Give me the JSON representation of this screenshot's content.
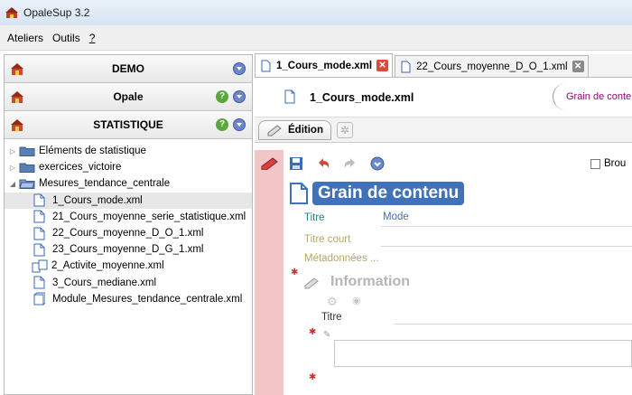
{
  "app": {
    "title": "OpaleSup 3.2"
  },
  "menu": [
    {
      "label": "Ateliers"
    },
    {
      "label": "Outils"
    },
    {
      "label": "?"
    }
  ],
  "workspaces": [
    {
      "name": "DEMO",
      "has_help": false
    },
    {
      "name": "Opale",
      "has_help": true
    },
    {
      "name": "STATISTIQUE",
      "has_help": true
    }
  ],
  "tree": [
    {
      "label": "Eléments de statistique",
      "type": "folder",
      "expanded": false
    },
    {
      "label": "exercices_victoire",
      "type": "folder",
      "expanded": false
    },
    {
      "label": "Mesures_tendance_centrale",
      "type": "folder",
      "expanded": true
    },
    {
      "label": "1_Cours_mode.xml",
      "type": "file",
      "selected": true
    },
    {
      "label": "21_Cours_moyenne_serie_statistique.xml",
      "type": "file"
    },
    {
      "label": "22_Cours_moyenne_D_O_1.xml",
      "type": "file"
    },
    {
      "label": "23_Cours_moyenne_D_G_1.xml",
      "type": "file"
    },
    {
      "label": "2_Activite_moyenne.xml",
      "type": "activity"
    },
    {
      "label": "3_Cours_mediane.xml",
      "type": "file"
    },
    {
      "label": "Module_Mesures_tendance_centrale.xml",
      "type": "module"
    }
  ],
  "tabs": [
    {
      "label": "1_Cours_mode.xml",
      "active": true
    },
    {
      "label": "22_Cours_moyenne_D_O_1.xml",
      "active": false
    }
  ],
  "document": {
    "name": "1_Cours_mode.xml",
    "type_label": "Grain de conte"
  },
  "edit_tab": {
    "label": "Édition"
  },
  "toolbar": {
    "brouillon_label": "Brou"
  },
  "form": {
    "heading": "Grain de contenu",
    "titre_label": "Titre",
    "titre_value": "Mode",
    "titre_court_label": "Titre court",
    "metadonnees_label": "Métadonnées ...",
    "information_label": "Information",
    "info_titre_label": "Titre"
  },
  "colors": {
    "accent": "#3f72b8",
    "red_strip": "#f2c6c6",
    "grain_text": "#8a0a6d"
  }
}
